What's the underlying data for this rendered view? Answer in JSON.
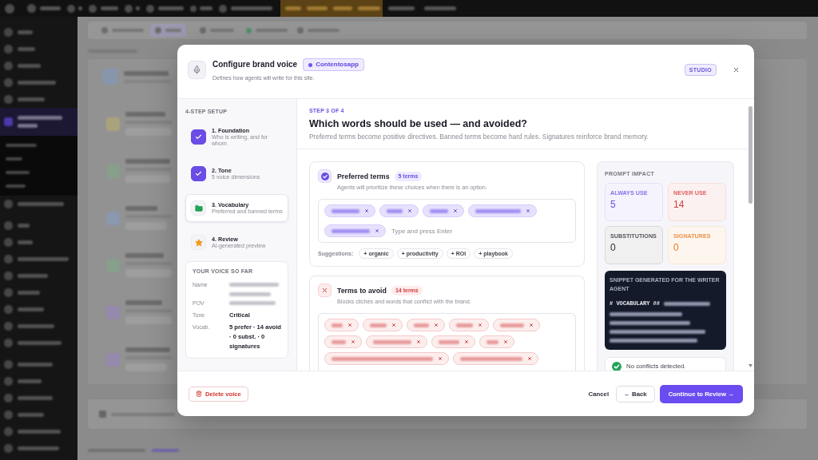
{
  "dialog": {
    "title": "Configure brand voice",
    "badge": "Contentosapp",
    "subtitle": "Defines how agents will write for this site.",
    "mode": "STUDIO"
  },
  "setup": {
    "heading": "4-STEP SETUP",
    "steps": [
      {
        "title": "1. Foundation",
        "subtitle": "Who is writing, and for whom",
        "done": true,
        "selected": false
      },
      {
        "title": "2. Tone",
        "subtitle": "5 voice dimensions",
        "done": true,
        "selected": false
      },
      {
        "title": "3. Vocabulary",
        "subtitle": "Preferred and banned terms",
        "done": false,
        "selected": true
      },
      {
        "title": "4. Review",
        "subtitle": "AI-generated preview",
        "done": false,
        "selected": false
      }
    ]
  },
  "summary": {
    "heading": "YOUR VOICE SO FAR",
    "rows": [
      {
        "label": "Name",
        "kind": "blurred"
      },
      {
        "label": "POV",
        "kind": "blurred"
      },
      {
        "label": "Tone",
        "kind": "text",
        "value": "Critical"
      },
      {
        "label": "Vocab.",
        "kind": "text",
        "value": "5 prefer · 14 avoid · 0 subst. · 0 signatures"
      }
    ]
  },
  "step": {
    "eyebrow": "STEP 3 OF 4",
    "heading": "Which words should be used — and avoided?",
    "description": "Preferred terms become positive directives. Banned terms become hard rules. Signatures reinforce brand memory."
  },
  "term_groups": [
    {
      "kind": "preferred",
      "title": "Preferred terms",
      "count": "5 terms",
      "subtitle": "Agents will prioritize these choices when there is an option.",
      "terms": [
        {
          "kind": "blurred"
        },
        {
          "kind": "blurred"
        },
        {
          "kind": "blurred"
        },
        {
          "kind": "blurred"
        },
        {
          "kind": "blurred"
        }
      ],
      "placeholder": "Type and press Enter",
      "suggestions_label": "Suggestions:",
      "suggestions": [
        "+ organic",
        "+ productivity",
        "+ ROI",
        "+ playbook"
      ]
    },
    {
      "kind": "avoid",
      "title": "Terms to avoid",
      "count": "14 terms",
      "subtitle": "Blocks clichés and words that conflict with the brand.",
      "terms": [
        {
          "kind": "blurred"
        },
        {
          "kind": "blurred"
        },
        {
          "kind": "blurred"
        },
        {
          "kind": "blurred"
        },
        {
          "kind": "blurred"
        },
        {
          "kind": "blurred"
        },
        {
          "kind": "blurred"
        },
        {
          "kind": "blurred"
        },
        {
          "kind": "blurred"
        },
        {
          "kind": "blurred"
        },
        {
          "kind": "blurred"
        }
      ]
    }
  ],
  "prompt_impact": {
    "heading": "PROMPT IMPACT",
    "stats": [
      {
        "label": "ALWAYS USE",
        "value": "5",
        "color": "#6b4de6"
      },
      {
        "label": "NEVER USE",
        "value": "14",
        "color": "#d63a3a"
      },
      {
        "label": "SUBSTITUTIONS",
        "value": "0",
        "color": "#2a2a33"
      },
      {
        "label": "SIGNATURES",
        "value": "0",
        "color": "#e5781d"
      }
    ],
    "snippet": {
      "title": "SNIPPET GENERATED FOR THE WRITER AGENT",
      "lines": [
        {
          "kind": "text",
          "text": "# VOCABULARY ##"
        },
        {
          "kind": "blurred"
        }
      ]
    },
    "status": "No conflicts detected."
  },
  "footer": {
    "delete": "Delete voice",
    "cancel": "Cancel",
    "back": "← Back",
    "next": "Continue to Review →"
  }
}
